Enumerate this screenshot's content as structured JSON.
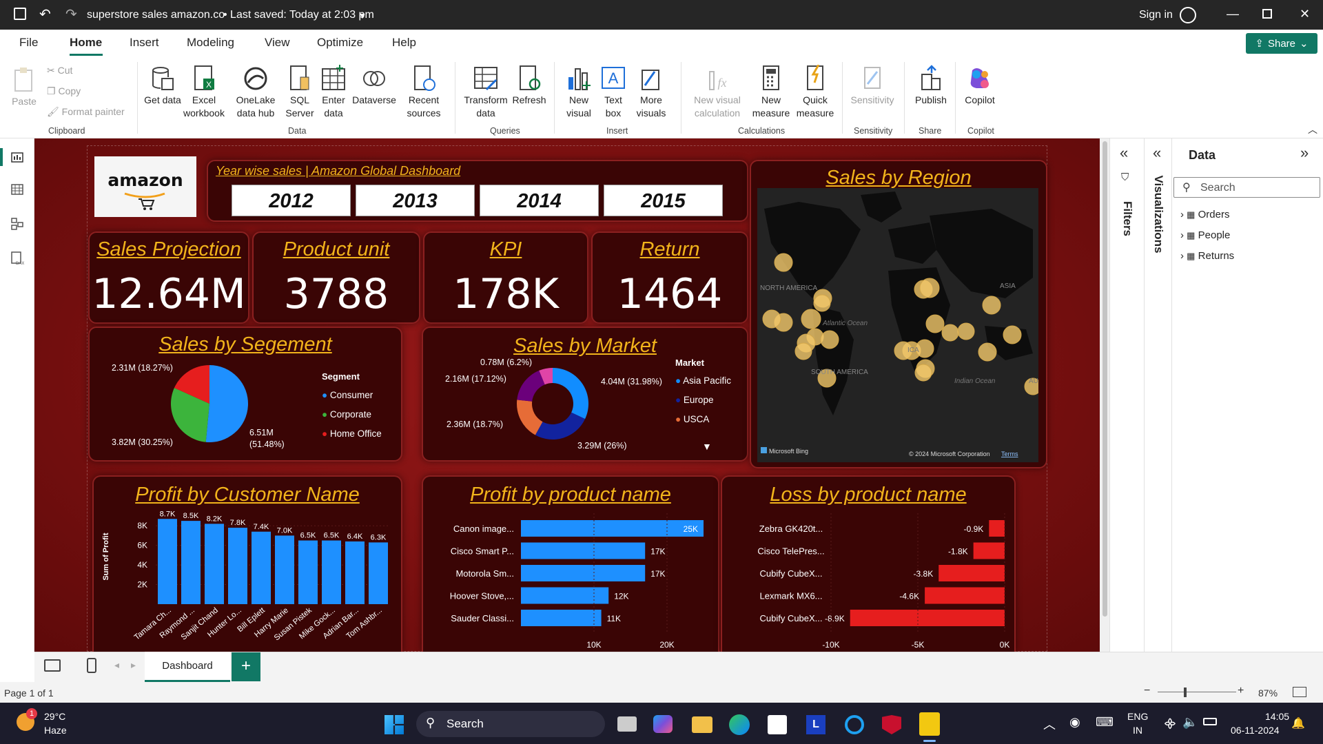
{
  "window": {
    "title": "superstore sales amazon.co",
    "saved": "• Last saved: Today at 2:03 pm",
    "sign_in": "Sign in"
  },
  "menu": [
    "File",
    "Home",
    "Insert",
    "Modeling",
    "View",
    "Optimize",
    "Help"
  ],
  "share_label": "Share",
  "ribbon": {
    "clipboard": {
      "paste": "Paste",
      "cut": "Cut",
      "copy": "Copy",
      "format_painter": "Format painter",
      "group": "Clipboard"
    },
    "data": {
      "get_data": "Get data",
      "excel": "Excel workbook",
      "onelake": "OneLake data hub",
      "sql": "SQL Server",
      "enter": "Enter data",
      "dataverse": "Dataverse",
      "recent": "Recent sources",
      "group": "Data"
    },
    "queries": {
      "transform": "Transform data",
      "refresh": "Refresh",
      "group": "Queries"
    },
    "insert": {
      "new_visual": "New visual",
      "text_box": "Text box",
      "more_visuals": "More visuals",
      "group": "Insert"
    },
    "calculations": {
      "new_visual_calc": "New visual calculation",
      "new_measure": "New measure",
      "quick_measure": "Quick measure",
      "group": "Calculations"
    },
    "sensitivity": {
      "label": "Sensitivity",
      "group": "Sensitivity"
    },
    "share": {
      "publish": "Publish",
      "group": "Share"
    },
    "copilot": {
      "label": "Copilot",
      "group": "Copilot"
    }
  },
  "dashboard": {
    "logo": "amazon",
    "header_title": "Year wise sales | Amazon Global Dashboard",
    "years": [
      "2012",
      "2013",
      "2014",
      "2015"
    ],
    "kpis": [
      {
        "title": "Sales Projection",
        "value": "12.64M"
      },
      {
        "title": "Product unit",
        "value": "3788"
      },
      {
        "title": "KPI",
        "value": "178K"
      },
      {
        "title": "Return",
        "value": "1464"
      }
    ],
    "segment": {
      "title": "Sales by Segement",
      "legend_title": "Segment",
      "labels": [
        "6.51M (51.48%)",
        "3.82M (30.25%)",
        "2.31M (18.27%)"
      ],
      "legend": [
        "Consumer",
        "Corporate",
        "Home Office"
      ],
      "colors": [
        "#1e90ff",
        "#3cb43c",
        "#e61e1e"
      ]
    },
    "market": {
      "title": "Sales by Market",
      "legend_title": "Market",
      "legend": [
        "Asia Pacific",
        "Europe",
        "USCA"
      ],
      "labels": [
        "4.04M (31.98%)",
        "3.29M (26%)",
        "2.36M (18.7%)",
        "2.16M (17.12%)",
        "0.78M (6.2%)"
      ],
      "colors": [
        "#118dff",
        "#12239e",
        "#e66c37",
        "#6b007b",
        "#e044a7"
      ]
    },
    "region": {
      "title": "Sales by Region",
      "labels": [
        "NORTH AMERICA",
        "SOUTH AMERICA",
        "ASIA",
        "Atlantic Ocean",
        "Indian Ocean",
        "AU",
        "ICA"
      ],
      "bing": "Microsoft Bing",
      "copyright": "© 2024 Microsoft Corporation",
      "terms": "Terms"
    },
    "profit_customer": {
      "title": "Profit by Customer Name",
      "ylabel": "Sum of Profit",
      "yticks": [
        "8K",
        "6K",
        "4K",
        "2K"
      ]
    },
    "profit_product": {
      "title": "Profit by product name",
      "xticks": [
        "10K",
        "20K"
      ]
    },
    "loss_product": {
      "title": "Loss by product name",
      "xticks": [
        "-10K",
        "-5K",
        "0K"
      ]
    }
  },
  "chart_data": [
    {
      "type": "pie",
      "title": "Sales by Segement",
      "categories": [
        "Consumer",
        "Corporate",
        "Home Office"
      ],
      "values": [
        6.51,
        3.82,
        2.31
      ],
      "unit": "M",
      "percent": [
        51.48,
        30.25,
        18.27
      ]
    },
    {
      "type": "pie",
      "title": "Sales by Market",
      "categories": [
        "Asia Pacific",
        "Europe",
        "USCA",
        "",
        "",
        ""
      ],
      "values": [
        4.04,
        3.29,
        2.36,
        2.16,
        0.78
      ],
      "unit": "M",
      "percent": [
        31.98,
        26,
        18.7,
        17.12,
        6.2
      ]
    },
    {
      "type": "bar",
      "title": "Profit by Customer Name",
      "categories": [
        "Tamara Ch...",
        "Raymond ...",
        "Sanjit Chand",
        "Hunter Lo...",
        "Bill Eplett",
        "Harry Marie",
        "Susan Pistek",
        "Mike Gock...",
        "Adrian Bar...",
        "Tom Ashbr..."
      ],
      "values": [
        8.7,
        8.5,
        8.2,
        7.8,
        7.4,
        7.0,
        6.5,
        6.5,
        6.4,
        6.3
      ],
      "labels": [
        "8.7K",
        "8.5K",
        "8.2K",
        "7.8K",
        "7.4K",
        "7.0K",
        "6.5K",
        "6.5K",
        "6.4K",
        "6.3K"
      ],
      "ylabel": "Sum of Profit",
      "ylim": [
        0,
        9
      ]
    },
    {
      "type": "bar",
      "title": "Profit by product name",
      "orientation": "horizontal",
      "categories": [
        "Canon image...",
        "Cisco Smart P...",
        "Motorola Sm...",
        "Hoover Stove,...",
        "Sauder Classi..."
      ],
      "values": [
        25,
        17,
        17,
        12,
        11
      ],
      "labels": [
        "25K",
        "17K",
        "17K",
        "12K",
        "11K"
      ],
      "xlim": [
        0,
        25
      ]
    },
    {
      "type": "bar",
      "title": "Loss by product name",
      "orientation": "horizontal",
      "categories": [
        "Zebra GK420t...",
        "Cisco TelePres...",
        "Cubify CubeX...",
        "Lexmark MX6...",
        "Cubify CubeX..."
      ],
      "values": [
        -0.9,
        -1.8,
        -3.8,
        -4.6,
        -8.9
      ],
      "labels": [
        "-0.9K",
        "-1.8K",
        "-3.8K",
        "-4.6K",
        "-8.9K"
      ],
      "xlim": [
        -10,
        0
      ]
    }
  ],
  "panes": {
    "filters": "Filters",
    "visualizations": "Visualizations",
    "data": "Data",
    "search_placeholder": "Search",
    "tables": [
      "Orders",
      "People",
      "Returns"
    ]
  },
  "tabs": {
    "page": "Dashboard",
    "page_count": "Page 1 of 1",
    "zoom": "87%"
  },
  "taskbar": {
    "temp": "29°C",
    "weather": "Haze",
    "search": "Search",
    "lang1": "ENG",
    "lang2": "IN",
    "time": "14:05",
    "date": "06-11-2024",
    "badge": "1"
  }
}
